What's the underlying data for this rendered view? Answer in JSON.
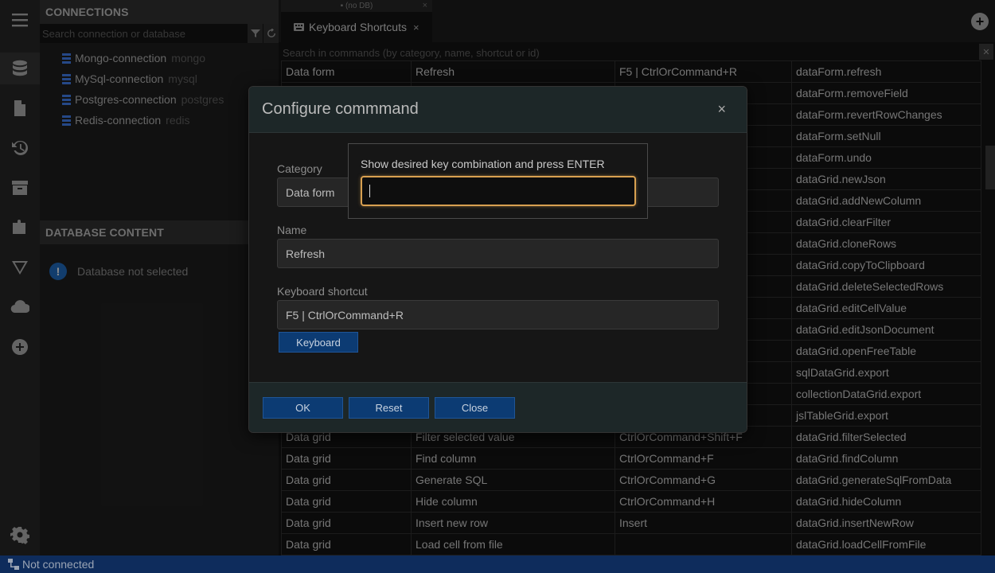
{
  "sidebar": {
    "icons": [
      "database-icon",
      "file-icon",
      "history-icon",
      "archive-icon",
      "plugin-icon",
      "filter-icon",
      "cloud-icon",
      "add-circle-icon",
      "settings-icon"
    ]
  },
  "connections": {
    "header": "CONNECTIONS",
    "search_placeholder": "Search connection or database",
    "items": [
      {
        "name": "Mongo-connection",
        "engine": "mongo"
      },
      {
        "name": "MySql-connection",
        "engine": "mysql"
      },
      {
        "name": "Postgres-connection",
        "engine": "postgres"
      },
      {
        "name": "Redis-connection",
        "engine": "redis"
      }
    ]
  },
  "database_content": {
    "header": "DATABASE CONTENT",
    "empty_text": "Database not selected"
  },
  "tabs": {
    "nodb_label": "(no DB)",
    "active_label": "Keyboard Shortcuts",
    "close_glyph": "×"
  },
  "commands": {
    "search_placeholder": "Search in commands (by category, name, shortcut or id)",
    "rows": [
      [
        "Data form",
        "Refresh",
        "F5 | CtrlOrCommand+R",
        "dataForm.refresh"
      ],
      [
        "",
        "",
        "",
        "dataForm.removeField"
      ],
      [
        "",
        "",
        "",
        "dataForm.revertRowChanges"
      ],
      [
        "",
        "",
        "",
        "dataForm.setNull"
      ],
      [
        "",
        "",
        "",
        "dataForm.undo"
      ],
      [
        "",
        "",
        "",
        "dataGrid.newJson"
      ],
      [
        "",
        "",
        "",
        "dataGrid.addNewColumn"
      ],
      [
        "",
        "",
        "",
        "dataGrid.clearFilter"
      ],
      [
        "",
        "",
        "",
        "dataGrid.cloneRows"
      ],
      [
        "",
        "",
        "",
        "dataGrid.copyToClipboard"
      ],
      [
        "",
        "",
        "",
        "dataGrid.deleteSelectedRows"
      ],
      [
        "",
        "",
        "",
        "dataGrid.editCellValue"
      ],
      [
        "",
        "",
        "",
        "dataGrid.editJsonDocument"
      ],
      [
        "",
        "",
        "",
        "dataGrid.openFreeTable"
      ],
      [
        "",
        "",
        "",
        "sqlDataGrid.export"
      ],
      [
        "",
        "",
        "",
        "collectionDataGrid.export"
      ],
      [
        "",
        "",
        "",
        "jslTableGrid.export"
      ],
      [
        "Data grid",
        "Filter selected value",
        "CtrlOrCommand+Shift+F",
        "dataGrid.filterSelected"
      ],
      [
        "Data grid",
        "Find column",
        "CtrlOrCommand+F",
        "dataGrid.findColumn"
      ],
      [
        "Data grid",
        "Generate SQL",
        "CtrlOrCommand+G",
        "dataGrid.generateSqlFromData"
      ],
      [
        "Data grid",
        "Hide column",
        "CtrlOrCommand+H",
        "dataGrid.hideColumn"
      ],
      [
        "Data grid",
        "Insert new row",
        "Insert",
        "dataGrid.insertNewRow"
      ],
      [
        "Data grid",
        "Load cell from file",
        "",
        "dataGrid.loadCellFromFile"
      ]
    ]
  },
  "modal": {
    "title": "Configure commmand",
    "close_glyph": "×",
    "category_label": "Category",
    "category_value": "Data form",
    "name_label": "Name",
    "name_value": "Refresh",
    "shortcut_label": "Keyboard shortcut",
    "shortcut_value": "F5 | CtrlOrCommand+R",
    "keyboard_button": "Keyboard",
    "ok_button": "OK",
    "reset_button": "Reset",
    "close_button": "Close"
  },
  "capture": {
    "prompt": "Show desired key combination and press ENTER",
    "value": ""
  },
  "status": {
    "text": "Not connected"
  },
  "colors": {
    "accent_blue": "#0c3b73",
    "statusbar": "#0e2c5c",
    "focus_ring": "#d8a050",
    "connection_icon": "#3a6fd0"
  }
}
